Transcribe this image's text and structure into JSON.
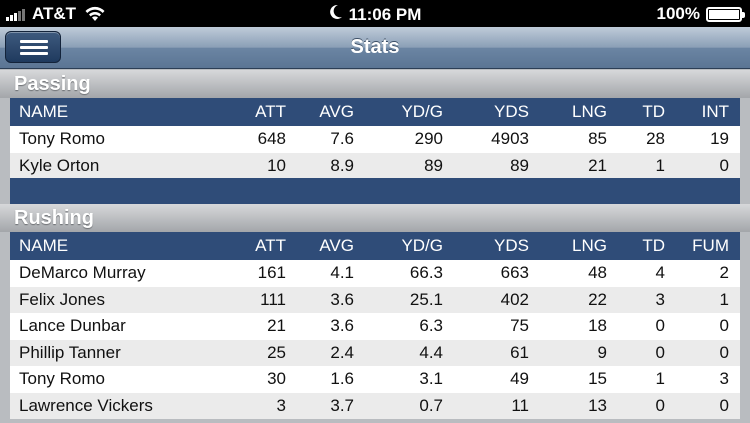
{
  "status": {
    "carrier": "AT&T",
    "time": "11:06 PM",
    "battery": "100%",
    "battery_level": 1.0
  },
  "nav": {
    "title": "Stats"
  },
  "passing": {
    "title": "Passing",
    "columns": [
      "NAME",
      "ATT",
      "AVG",
      "YD/G",
      "YDS",
      "LNG",
      "TD",
      "INT"
    ],
    "rows": [
      [
        "Tony Romo",
        "648",
        "7.6",
        "290",
        "4903",
        "85",
        "28",
        "19"
      ],
      [
        "Kyle Orton",
        "10",
        "8.9",
        "89",
        "89",
        "21",
        "1",
        "0"
      ]
    ]
  },
  "rushing": {
    "title": "Rushing",
    "columns": [
      "NAME",
      "ATT",
      "AVG",
      "YD/G",
      "YDS",
      "LNG",
      "TD",
      "FUM"
    ],
    "rows": [
      [
        "DeMarco Murray",
        "161",
        "4.1",
        "66.3",
        "663",
        "48",
        "4",
        "2"
      ],
      [
        "Felix Jones",
        "111",
        "3.6",
        "25.1",
        "402",
        "22",
        "3",
        "1"
      ],
      [
        "Lance Dunbar",
        "21",
        "3.6",
        "6.3",
        "75",
        "18",
        "0",
        "0"
      ],
      [
        "Phillip Tanner",
        "25",
        "2.4",
        "4.4",
        "61",
        "9",
        "0",
        "0"
      ],
      [
        "Tony Romo",
        "30",
        "1.6",
        "3.1",
        "49",
        "15",
        "1",
        "3"
      ],
      [
        "Lawrence Vickers",
        "3",
        "3.7",
        "0.7",
        "11",
        "13",
        "0",
        "0"
      ]
    ]
  }
}
